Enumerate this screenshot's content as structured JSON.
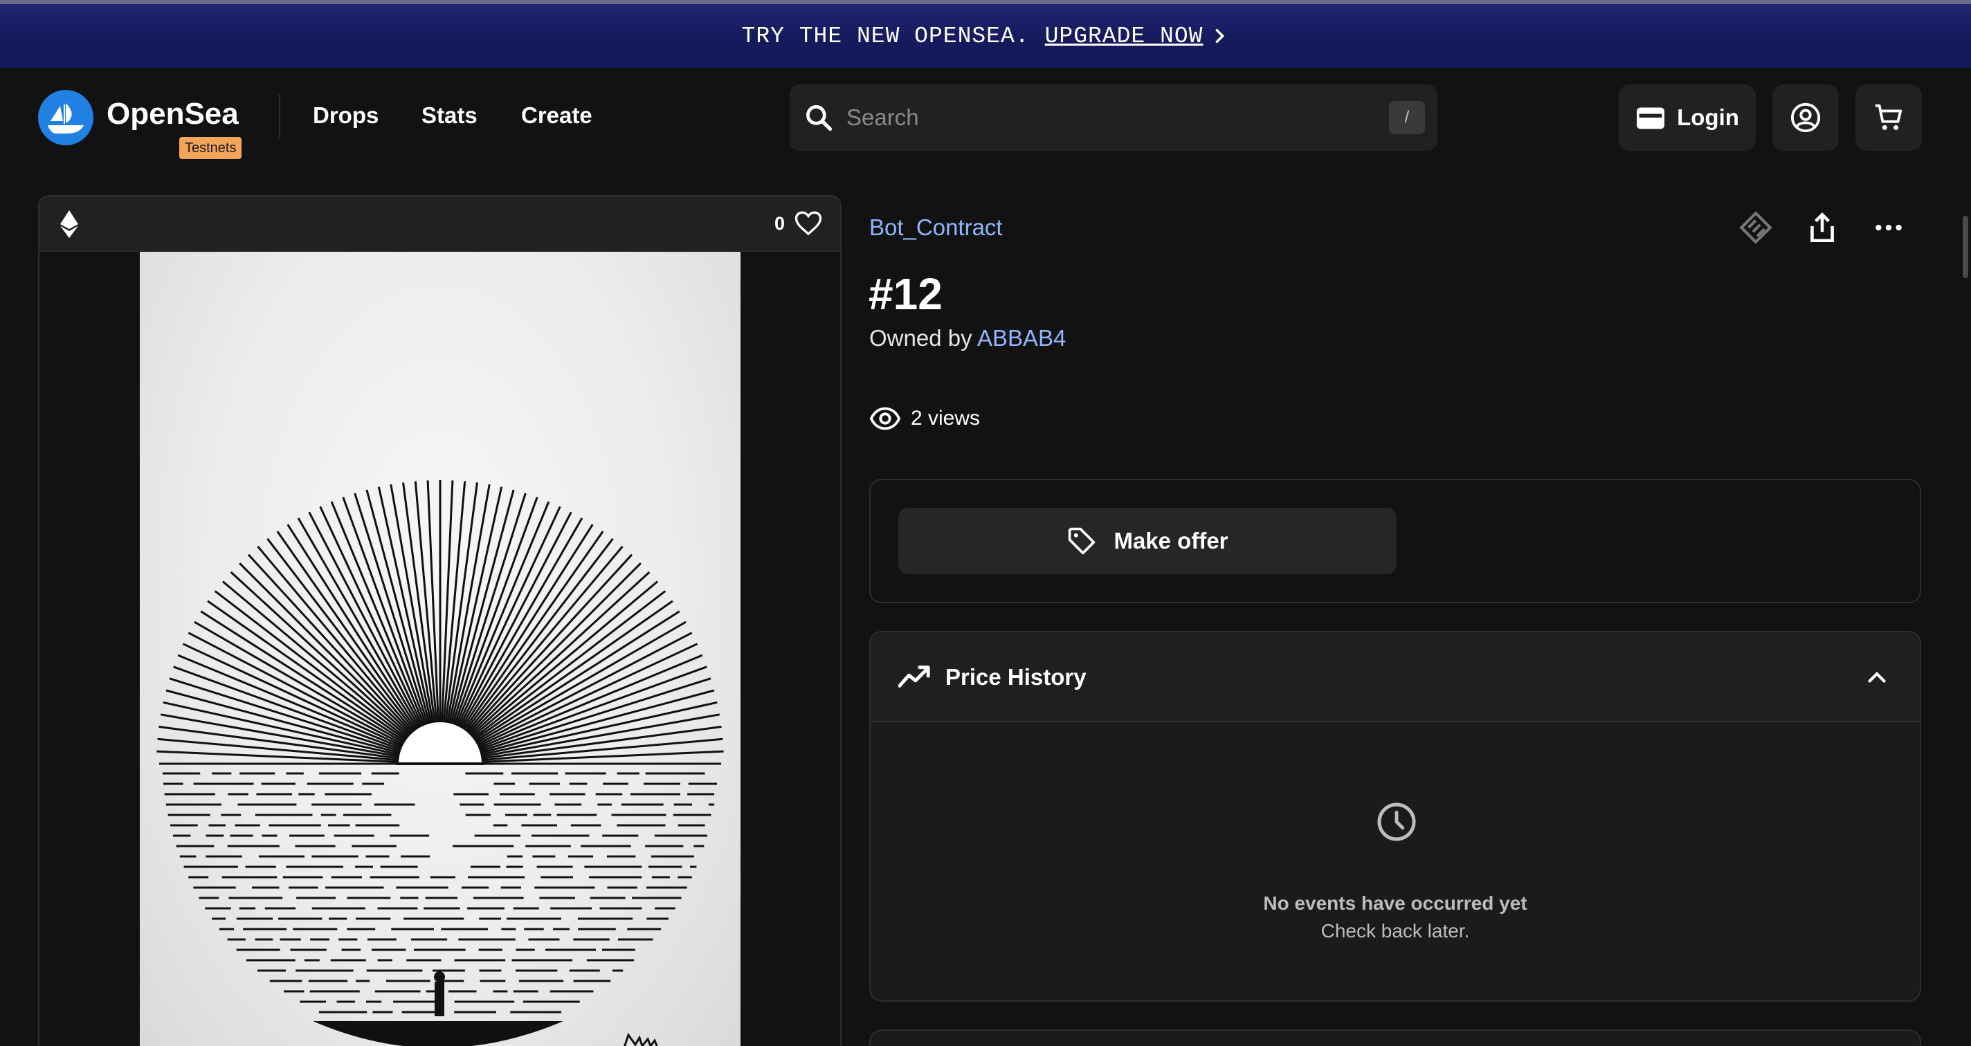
{
  "banner": {
    "text": "TRY THE NEW OPENSEA.",
    "link": "UPGRADE NOW"
  },
  "header": {
    "brand": "OpenSea",
    "badge": "Testnets",
    "nav": [
      "Drops",
      "Stats",
      "Create"
    ],
    "search_placeholder": "Search",
    "search_shortcut": "/",
    "login_label": "Login"
  },
  "item": {
    "collection": "Bot_Contract",
    "title": "#12",
    "owned_by_label": "Owned by",
    "owner": "ABBAB4",
    "views": "2 views",
    "favorites": "0",
    "chain_icon": "ethereum-icon"
  },
  "offer": {
    "button_label": "Make offer"
  },
  "price_history": {
    "title": "Price History",
    "empty_title": "No events have occurred yet",
    "empty_subtitle": "Check back later."
  },
  "colors": {
    "brand_blue": "#2081e2",
    "link_blue": "#8fb6ff",
    "badge_orange": "#f5a55a",
    "banner_navy": "#141a5c"
  }
}
